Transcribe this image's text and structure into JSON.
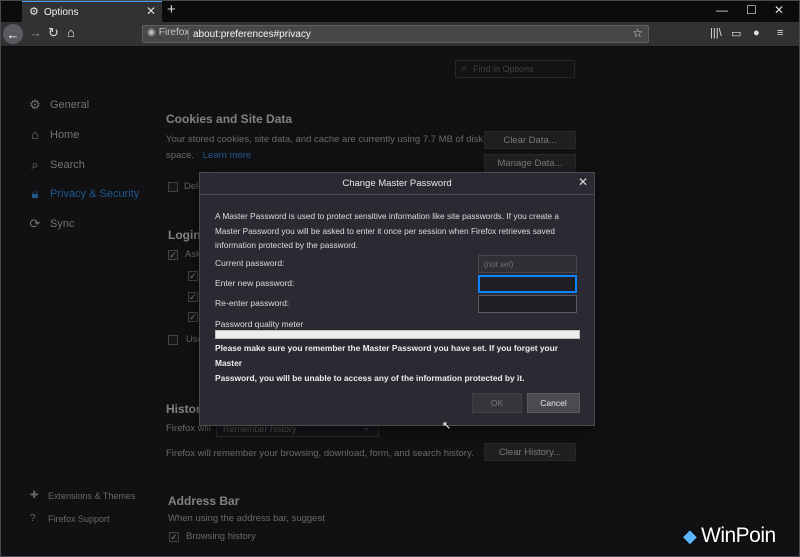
{
  "browser": {
    "tab_title": "Options",
    "new_tab_label": "+",
    "identity_label": "Firefox",
    "url": "about:preferences#privacy"
  },
  "find_in_options": {
    "placeholder": "Find in Options"
  },
  "sidebar": {
    "items": [
      {
        "label": "General",
        "icon": "gear-icon"
      },
      {
        "label": "Home",
        "icon": "home-icon"
      },
      {
        "label": "Search",
        "icon": "search-icon"
      },
      {
        "label": "Privacy & Security",
        "icon": "lock-icon",
        "active": true
      },
      {
        "label": "Sync",
        "icon": "sync-icon"
      }
    ],
    "footer": [
      {
        "label": "Extensions & Themes",
        "icon": "puzzle-icon"
      },
      {
        "label": "Firefox Support",
        "icon": "help-icon"
      }
    ]
  },
  "cookies": {
    "title": "Cookies and Site Data",
    "description_line1": "Your stored cookies, site data, and cache are currently using 7.7 MB of disk",
    "description_line2": "space.",
    "learn_more": "Learn more",
    "clear_data": "Clear Data...",
    "manage_data": "Manage Data...",
    "delete_label": "Dele"
  },
  "logins": {
    "title": "Logins",
    "ask_label": "Ask",
    "use_label": "Use"
  },
  "history": {
    "title": "History",
    "firefox_will": "Firefox will",
    "mode": "Remember history",
    "description": "Firefox will remember your browsing, download, form, and search history.",
    "clear_history": "Clear History..."
  },
  "address_bar": {
    "title": "Address Bar",
    "description": "When using the address bar, suggest",
    "browsing_history": "Browsing history"
  },
  "dialog": {
    "title": "Change Master Password",
    "intro_line1": "A Master Password is used to protect sensitive information like site passwords. If you create a",
    "intro_line2": "Master Password you will be asked to enter it once per session when Firefox retrieves saved",
    "intro_line3": "information protected by the password.",
    "current_password_label": "Current password:",
    "current_password_placeholder": "(not set)",
    "new_password_label": "Enter new password:",
    "reenter_password_label": "Re-enter password:",
    "quality_meter_label": "Password quality meter",
    "quality_meter_value": 0,
    "warning_line1": "Please make sure you remember the Master Password you have set. If you forget your Master",
    "warning_line2": "Password, you will be unable to access any of the information protected by it.",
    "ok_label": "OK",
    "cancel_label": "Cancel"
  },
  "watermark": "WinPoin",
  "colors": {
    "accent": "#0a84ff",
    "link": "#3aa0ff",
    "background": "#202023"
  }
}
